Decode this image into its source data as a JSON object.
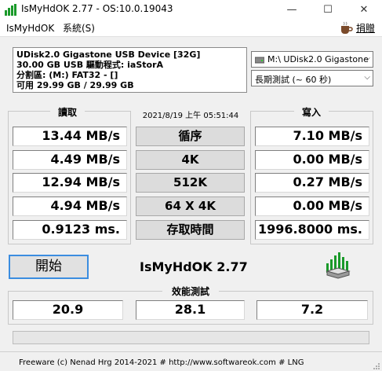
{
  "window": {
    "title": "IsMyHdOK 2.77 - OS:10.0.19043",
    "minimize": "—",
    "maximize": "☐",
    "close": "✕"
  },
  "menu": {
    "app": "IsMyHdOK",
    "system": "系統(S)",
    "donate": "捐贈",
    "donate_icon": "coffee-cup-icon"
  },
  "device": {
    "name_line": "UDisk2.0 Gigastone USB Device [32G]",
    "size_line": "30.00 GB  USB 驅動程式: iaStorA",
    "partition_line": "分割區: (M:) FAT32 - []",
    "free_line": "可用 29.99 GB / 29.99 GB"
  },
  "selectors": {
    "drive": "M:\\ UDisk2.0 Gigastone",
    "test_mode": "長期測試 (~ 60 秒)"
  },
  "read": {
    "title": "讀取",
    "values": [
      "13.44 MB/s",
      "4.49 MB/s",
      "12.94 MB/s",
      "4.94 MB/s",
      "0.9123 ms."
    ]
  },
  "write": {
    "title": "寫入",
    "values": [
      "7.10 MB/s",
      "0.00 MB/s",
      "0.27 MB/s",
      "0.00 MB/s",
      "1996.8000 ms."
    ]
  },
  "middle": {
    "datetime": "2021/8/19 上午 05:51:44",
    "labels": [
      "循序",
      "4K",
      "512K",
      "64 X 4K",
      "存取時間"
    ]
  },
  "start_button": "開始",
  "app_name": "IsMyHdOK 2.77",
  "performance": {
    "title": "效能測試",
    "values": [
      "20.9",
      "28.1",
      "7.2"
    ]
  },
  "progress": 0,
  "status": "Freeware (c) Nenad Hrg 2014-2021 # http://www.softwareok.com      # LNG",
  "colors": {
    "accent": "#3b8de0",
    "icon_green": "#1a9a2a"
  }
}
